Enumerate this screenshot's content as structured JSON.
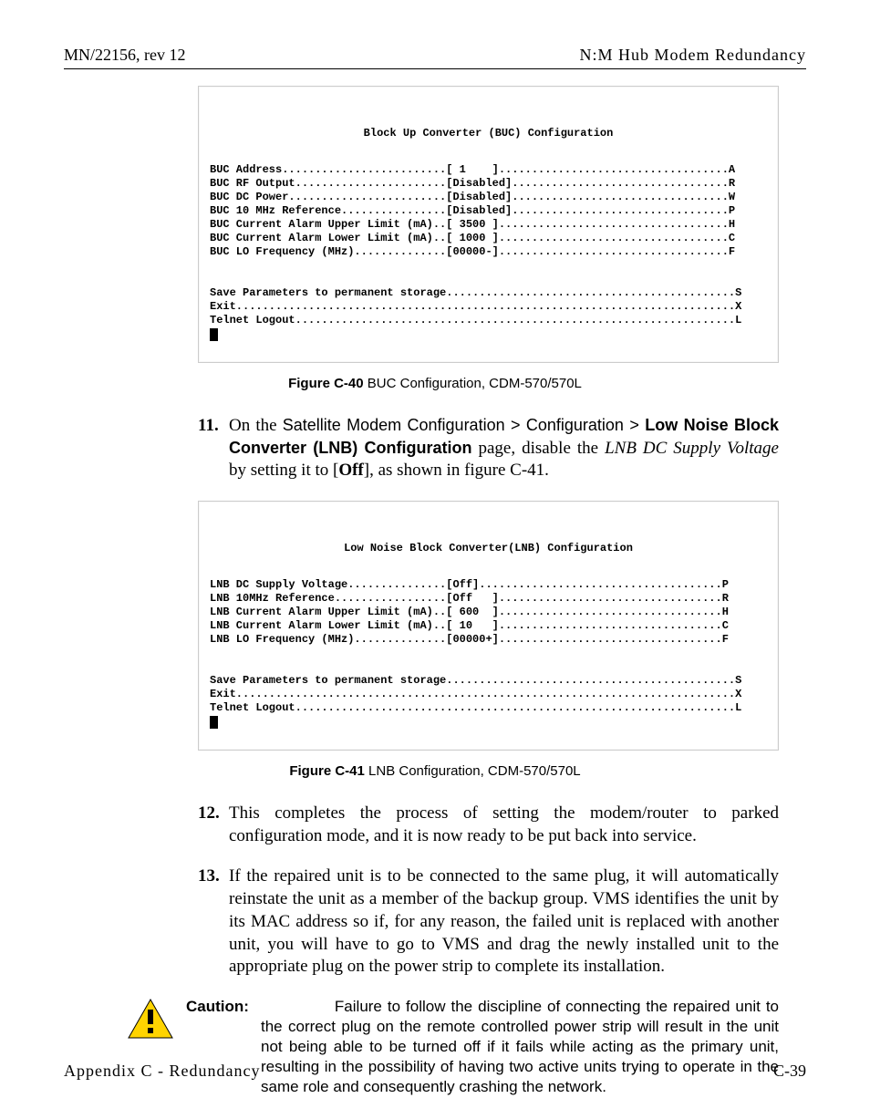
{
  "header": {
    "left": "MN/22156, rev 12",
    "right": "N:M Hub Modem Redundancy"
  },
  "term1": {
    "title": "Block Up Converter (BUC) Configuration",
    "lines": [
      "BUC Address.........................[ 1    ]...................................A",
      "BUC RF Output.......................[Disabled].................................R",
      "BUC DC Power........................[Disabled].................................W",
      "BUC 10 MHz Reference................[Disabled].................................P",
      "BUC Current Alarm Upper Limit (mA)..[ 3500 ]...................................H",
      "BUC Current Alarm Lower Limit (mA)..[ 1000 ]...................................C",
      "BUC LO Frequency (MHz)..............[00000-]...................................F",
      "",
      "",
      "Save Parameters to permanent storage............................................S",
      "Exit............................................................................X",
      "Telnet Logout...................................................................L"
    ]
  },
  "caption1": {
    "bold": "Figure C-40",
    "rest": "  BUC Configuration, CDM-570/570L"
  },
  "step11": {
    "num": "11.",
    "parts": {
      "a": "On the ",
      "b": "Satellite Modem Configuration > Configuration > ",
      "c": "Low Noise Block Converter (LNB) Configuration",
      "d": " page, disable the ",
      "e": "LNB DC Supply Voltage",
      "f": " by setting it to [",
      "g": "Off",
      "h": "], as shown in figure C-41."
    }
  },
  "term2": {
    "title": "Low Noise Block Converter(LNB) Configuration",
    "lines": [
      "LNB DC Supply Voltage...............[Off].....................................P",
      "LNB 10MHz Reference.................[Off   ]..................................R",
      "LNB Current Alarm Upper Limit (mA)..[ 600  ]..................................H",
      "LNB Current Alarm Lower Limit (mA)..[ 10   ]..................................C",
      "LNB LO Frequency (MHz)..............[00000+]..................................F",
      "",
      "",
      "Save Parameters to permanent storage............................................S",
      "Exit............................................................................X",
      "Telnet Logout...................................................................L"
    ]
  },
  "caption2": {
    "bold": "Figure C-41",
    "rest": "  LNB Configuration, CDM-570/570L"
  },
  "step12": {
    "num": "12.",
    "text": "This completes the process of setting the modem/router to parked configuration mode, and it is now ready to be put back into service."
  },
  "step13": {
    "num": "13.",
    "text": "If the repaired unit is to be connected to the same plug, it will automatically reinstate the unit as a member of the backup group. VMS identifies the unit by its MAC address so if, for any reason, the failed unit is replaced with another unit, you will have to go to VMS and drag the newly installed unit to the appropriate plug on the power strip to complete its installation."
  },
  "caution": {
    "label": "Caution:",
    "text": "Failure to follow the discipline of connecting the repaired unit to the correct plug on the remote controlled power strip will result in the unit not being able to be turned off if it fails while acting as the primary unit, resulting in the possibility of having two active units trying to operate in the same role and consequently crashing the network."
  },
  "footer": {
    "left": "Appendix C - Redundancy",
    "right": "C-39"
  }
}
